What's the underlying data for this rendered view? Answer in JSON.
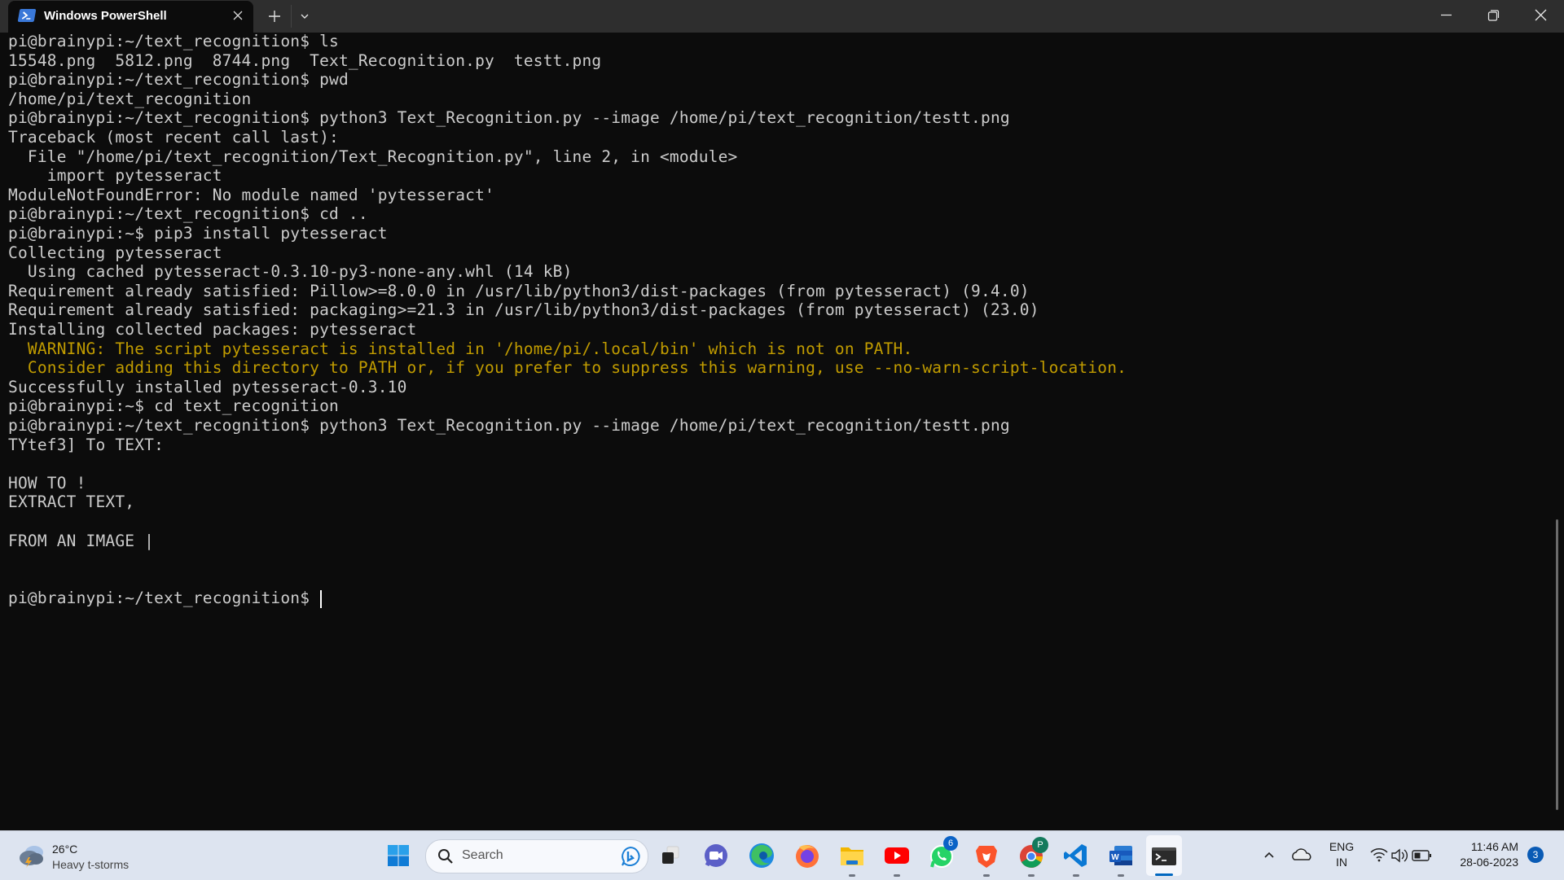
{
  "window": {
    "tab_title": "Windows PowerShell",
    "tab_icon": "powershell-icon",
    "controls": [
      "minimize",
      "maximize",
      "close"
    ]
  },
  "terminal": {
    "colors": {
      "background": "#0c0c0c",
      "foreground": "#cccccc",
      "warning": "#c19c00"
    },
    "lines": [
      {
        "text": "pi@brainypi:~/text_recognition$ ls",
        "type": "prompt"
      },
      {
        "text": "15548.png  5812.png  8744.png  Text_Recognition.py  testt.png",
        "type": "output"
      },
      {
        "text": "pi@brainypi:~/text_recognition$ pwd",
        "type": "prompt"
      },
      {
        "text": "/home/pi/text_recognition",
        "type": "output"
      },
      {
        "text": "pi@brainypi:~/text_recognition$ python3 Text_Recognition.py --image /home/pi/text_recognition/testt.png",
        "type": "prompt"
      },
      {
        "text": "Traceback (most recent call last):",
        "type": "output"
      },
      {
        "text": "  File \"/home/pi/text_recognition/Text_Recognition.py\", line 2, in <module>",
        "type": "output"
      },
      {
        "text": "    import pytesseract",
        "type": "output"
      },
      {
        "text": "ModuleNotFoundError: No module named 'pytesseract'",
        "type": "output"
      },
      {
        "text": "pi@brainypi:~/text_recognition$ cd ..",
        "type": "prompt"
      },
      {
        "text": "pi@brainypi:~$ pip3 install pytesseract",
        "type": "prompt"
      },
      {
        "text": "Collecting pytesseract",
        "type": "output"
      },
      {
        "text": "  Using cached pytesseract-0.3.10-py3-none-any.whl (14 kB)",
        "type": "output"
      },
      {
        "text": "Requirement already satisfied: Pillow>=8.0.0 in /usr/lib/python3/dist-packages (from pytesseract) (9.4.0)",
        "type": "output"
      },
      {
        "text": "Requirement already satisfied: packaging>=21.3 in /usr/lib/python3/dist-packages (from pytesseract) (23.0)",
        "type": "output"
      },
      {
        "text": "Installing collected packages: pytesseract",
        "type": "output"
      },
      {
        "text": "  WARNING: The script pytesseract is installed in '/home/pi/.local/bin' which is not on PATH.",
        "type": "warning"
      },
      {
        "text": "  Consider adding this directory to PATH or, if you prefer to suppress this warning, use --no-warn-script-location.",
        "type": "warning"
      },
      {
        "text": "Successfully installed pytesseract-0.3.10",
        "type": "output"
      },
      {
        "text": "pi@brainypi:~$ cd text_recognition",
        "type": "prompt"
      },
      {
        "text": "pi@brainypi:~/text_recognition$ python3 Text_Recognition.py --image /home/pi/text_recognition/testt.png",
        "type": "prompt"
      },
      {
        "text": "TYtef3] To TEXT:",
        "type": "output"
      },
      {
        "text": "",
        "type": "output"
      },
      {
        "text": "HOW TO !",
        "type": "output"
      },
      {
        "text": "EXTRACT TEXT,",
        "type": "output"
      },
      {
        "text": "",
        "type": "output"
      },
      {
        "text": "FROM AN IMAGE |",
        "type": "output"
      },
      {
        "text": "",
        "type": "output"
      },
      {
        "text": "",
        "type": "output"
      },
      {
        "text": "pi@brainypi:~/text_recognition$ ",
        "type": "current-prompt"
      }
    ]
  },
  "taskbar": {
    "weather": {
      "temp": "26°C",
      "desc": "Heavy t-storms"
    },
    "search_placeholder": "Search",
    "apps": [
      {
        "name": "start",
        "label": "Start"
      },
      {
        "name": "task-view",
        "label": "Task View"
      },
      {
        "name": "teams",
        "label": "Microsoft Teams"
      },
      {
        "name": "edge",
        "label": "Microsoft Edge"
      },
      {
        "name": "firefox",
        "label": "Firefox"
      },
      {
        "name": "file-explorer",
        "label": "File Explorer",
        "running": true
      },
      {
        "name": "youtube",
        "label": "YouTube",
        "running": true
      },
      {
        "name": "whatsapp",
        "label": "WhatsApp",
        "badge": "6"
      },
      {
        "name": "brave",
        "label": "Brave",
        "running": true
      },
      {
        "name": "chrome",
        "label": "Google Chrome",
        "badge": "P",
        "running": true
      },
      {
        "name": "vscode",
        "label": "Visual Studio Code",
        "running": true
      },
      {
        "name": "word",
        "label": "Microsoft Word",
        "running": true
      },
      {
        "name": "terminal",
        "label": "Terminal",
        "active": true
      }
    ],
    "tray": {
      "lang_top": "ENG",
      "lang_bottom": "IN",
      "time": "11:46 AM",
      "date": "28-06-2023",
      "notifications": "3"
    }
  }
}
